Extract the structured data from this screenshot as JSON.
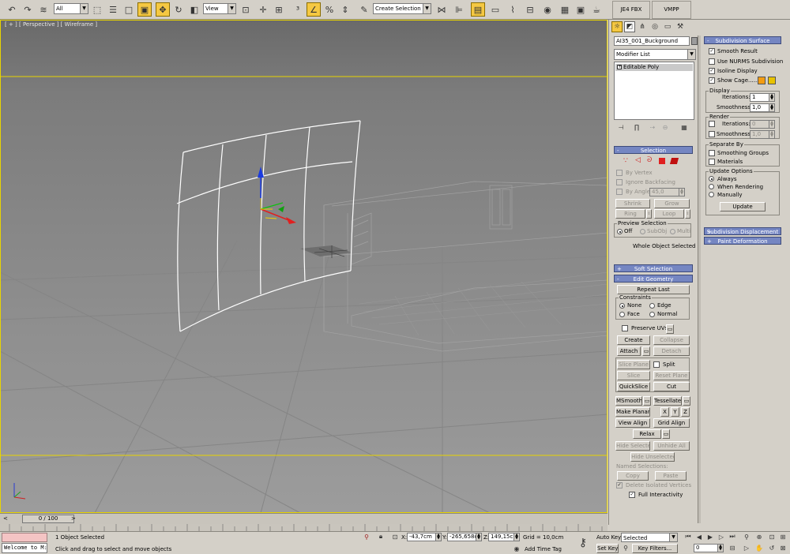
{
  "toolbar": {
    "selection_filter": "All",
    "reference_coord": "View",
    "named_selection_placeholder": "Create Selection Se",
    "tab_fbx": "JE4 FBX Expor",
    "tab_vmpp": "VMPP"
  },
  "viewport": {
    "label": "[ + ] [ Perspective ] [ Wireframe ]"
  },
  "panel": {
    "object_name": "AI35_001_Buckground",
    "modifier_list": "Modifier List",
    "stack_item": "Editable Poly",
    "selection": {
      "title": "Selection",
      "by_vertex": "By Vertex",
      "ignore_backfacing": "Ignore Backfacing",
      "by_angle": "By Angle:",
      "angle_value": "45,0",
      "shrink": "Shrink",
      "grow": "Grow",
      "ring": "Ring",
      "loop": "Loop",
      "preview_selection": "Preview Selection",
      "off": "Off",
      "subobj": "SubObj",
      "multi": "Multi",
      "status": "Whole Object Selected"
    },
    "soft_selection": "Soft Selection",
    "edit_geometry": {
      "title": "Edit Geometry",
      "repeat_last": "Repeat Last",
      "constraints": "Constraints",
      "none": "None",
      "edge": "Edge",
      "face": "Face",
      "normal": "Normal",
      "preserve_uvs": "Preserve UVs",
      "create": "Create",
      "collapse": "Collapse",
      "attach": "Attach",
      "detach": "Detach",
      "slice_plane": "Slice Plane",
      "split": "Split",
      "slice": "Slice",
      "reset_plane": "Reset Plane",
      "quickslice": "QuickSlice",
      "cut": "Cut",
      "msmooth": "MSmooth",
      "tessellate": "Tessellate",
      "make_planar": "Make Planar",
      "x": "X",
      "y": "Y",
      "z": "Z",
      "view_align": "View Align",
      "grid_align": "Grid Align",
      "relax": "Relax",
      "hide_selected": "Hide Selected",
      "unhide_all": "Unhide All",
      "hide_unselected": "Hide Unselected",
      "named_selections": "Named Selections:",
      "copy": "Copy",
      "paste": "Paste",
      "delete_isolated": "Delete Isolated Vertices",
      "full_interactivity": "Full Interactivity"
    },
    "subdivision_surface": {
      "title": "Subdivision Surface",
      "smooth_result": "Smooth Result",
      "use_nurms": "Use NURMS Subdivision",
      "isoline_display": "Isoline Display",
      "show_cage": "Show Cage......",
      "display": "Display",
      "iterations": "Iterations:",
      "display_iterations": "1",
      "smoothness": "Smoothness:",
      "display_smoothness": "1,0",
      "render": "Render",
      "render_iterations": "0",
      "render_smoothness": "1,0",
      "separate_by": "Separate By",
      "smoothing_groups": "Smoothing Groups",
      "materials": "Materials",
      "update_options": "Update Options",
      "always": "Always",
      "when_rendering": "When Rendering",
      "manually": "Manually",
      "update": "Update"
    },
    "subdivision_displacement": "Subdivision Displacement",
    "paint_deformation": "Paint Deformation"
  },
  "timeline": {
    "frame": "0 / 100"
  },
  "status": {
    "maxscript": "Welcome to M:",
    "selected": "1 Object Selected",
    "prompt": "Click and drag to select and move objects",
    "x_label": "X:",
    "x_value": "-43,7cm",
    "y_label": "Y:",
    "y_value": "-265,658cr",
    "z_label": "Z:",
    "z_value": "149,15cm",
    "grid": "Grid = 10,0cm",
    "add_time_tag": "Add Time Tag",
    "auto_key": "Auto Key",
    "set_key": "Set Key",
    "key_mode": "Selected",
    "key_filters": "Key Filters...",
    "frame_field": "0"
  },
  "colors": {
    "viewport_bg": "#747474",
    "selection_border": "#e8d400",
    "rollout_header": "#7586c2",
    "cage_color_1": "#f39c12",
    "cage_color_2": "#e8c200"
  }
}
